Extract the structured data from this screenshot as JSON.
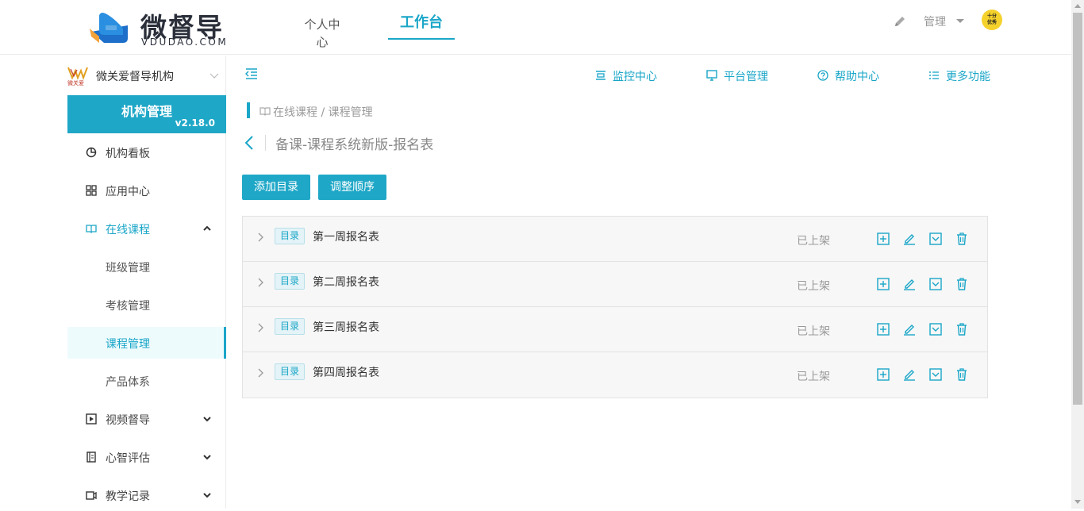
{
  "brand": {
    "name": "微督导",
    "domain": "VDUDAO.COM",
    "accent": "#1aa6c8"
  },
  "top_tabs": [
    {
      "label": "个人中心",
      "active": false
    },
    {
      "label": "工作台",
      "active": true
    }
  ],
  "user": {
    "label": "管理",
    "avatar_text": "十分优秀"
  },
  "sidebar": {
    "org_name": "微关爱督导机构",
    "org_logo_text": "微关爱",
    "panel_title": "机构管理",
    "version": "v2.18.0",
    "items": [
      {
        "label": "机构看板",
        "icon": "pie-chart-icon"
      },
      {
        "label": "应用中心",
        "icon": "grid-icon"
      },
      {
        "label": "在线课程",
        "icon": "book-open-icon",
        "state": "open"
      },
      {
        "label": "班级管理",
        "sub": true
      },
      {
        "label": "考核管理",
        "sub": true
      },
      {
        "label": "课程管理",
        "sub": true,
        "selected": true
      },
      {
        "label": "产品体系",
        "sub": true
      },
      {
        "label": "视频督导",
        "icon": "play-icon"
      },
      {
        "label": "心智评估",
        "icon": "notebook-icon"
      },
      {
        "label": "教学记录",
        "icon": "camera-icon"
      }
    ]
  },
  "toolbar": [
    {
      "label": "监控中心",
      "icon": "monitor-list-icon"
    },
    {
      "label": "平台管理",
      "icon": "desktop-icon"
    },
    {
      "label": "帮助中心",
      "icon": "help-circle-icon"
    },
    {
      "label": "更多功能",
      "icon": "list-icon"
    }
  ],
  "breadcrumb": "在线课程 / 课程管理",
  "page_title": "备课-课程系统新版-报名表",
  "buttons": {
    "add": "添加目录",
    "reorder": "调整顺序"
  },
  "rows": [
    {
      "tag": "目录",
      "name": "第一周报名表",
      "status": "已上架"
    },
    {
      "tag": "目录",
      "name": "第二周报名表",
      "status": "已上架"
    },
    {
      "tag": "目录",
      "name": "第三周报名表",
      "status": "已上架"
    },
    {
      "tag": "目录",
      "name": "第四周报名表",
      "status": "已上架"
    }
  ]
}
